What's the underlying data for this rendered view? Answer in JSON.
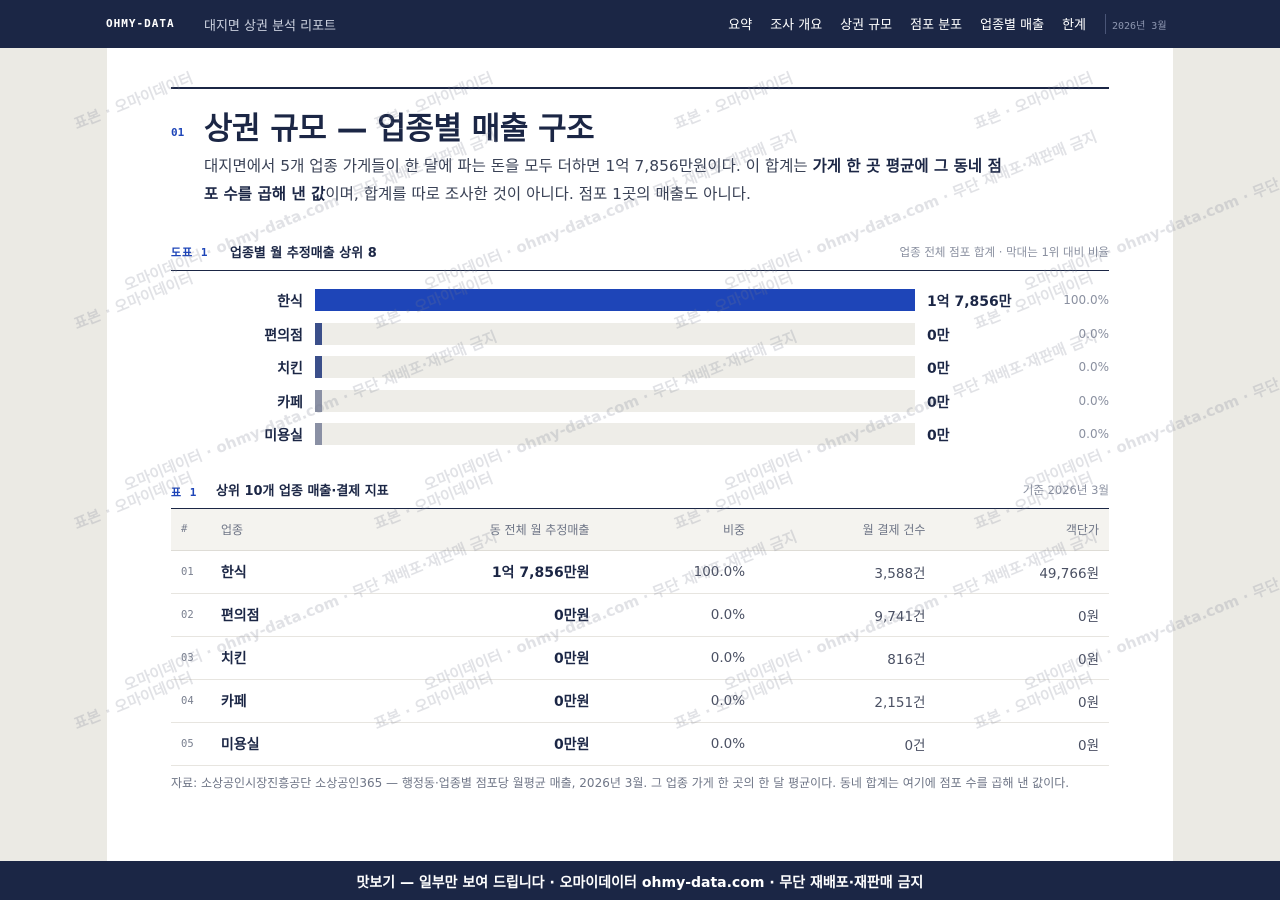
{
  "header": {
    "brand": "OHMY-DATA",
    "report_title": "대지면 상권 분석 리포트",
    "nav": [
      "요약",
      "조사 개요",
      "상권 규모",
      "점포 분포",
      "업종별 매출",
      "한계"
    ],
    "date": "2026년 3월"
  },
  "section": {
    "number": "01",
    "title": "상권 규모 — 업종별 매출 구조",
    "lead_1": "대지면에서 5개 업종 가게들이 한 달에 파는 돈을 모두 더하면 1억 7,856만원이다. 이 합계는 ",
    "lead_bold": "가게 한 곳 평균에 그 동네 점포 수를 곱해 낸 값",
    "lead_2": "이며, 합계를 따로 조사한 것이 아니다. 점포 1곳의 매출도 아니다."
  },
  "figure": {
    "label": "도표 1",
    "title": "업종별 월 추정매출 상위 8",
    "note": "업종 전체 점포 합계 · 막대는 1위 대비 비율"
  },
  "chart_data": {
    "type": "bar",
    "orientation": "horizontal",
    "categories": [
      "한식",
      "편의점",
      "치킨",
      "카페",
      "미용실"
    ],
    "values": [
      17856,
      0,
      0,
      0,
      0
    ],
    "value_labels": [
      "1억 7,856만",
      "0만",
      "0만",
      "0만",
      "0만"
    ],
    "pct_labels": [
      "100.0%",
      "0.0%",
      "0.0%",
      "0.0%",
      "0.0%"
    ],
    "colors": [
      "#1e45b8",
      "#3b4f8a",
      "#3b4f8a",
      "#8a90a4",
      "#8a90a4"
    ],
    "unit": "만원"
  },
  "table": {
    "label": "표 1",
    "title": "상위 10개 업종 매출·결제 지표",
    "note": "기준 2026년 3월",
    "columns": [
      "#",
      "업종",
      "동 전체 월 추정매출",
      "비중",
      "월 결제 건수",
      "객단가"
    ],
    "rows": [
      [
        "01",
        "한식",
        "1억 7,856만원",
        "100.0%",
        "3,588건",
        "49,766원"
      ],
      [
        "02",
        "편의점",
        "0만원",
        "0.0%",
        "9,741건",
        "0원"
      ],
      [
        "03",
        "치킨",
        "0만원",
        "0.0%",
        "816건",
        "0원"
      ],
      [
        "04",
        "카페",
        "0만원",
        "0.0%",
        "2,151건",
        "0원"
      ],
      [
        "05",
        "미용실",
        "0만원",
        "0.0%",
        "0건",
        "0원"
      ]
    ]
  },
  "source": "자료: 소상공인시장진흥공단 소상공인365 — 행정동·업종별 점포당 월평균 매출, 2026년 3월. 그 업종 가게 한 곳의 한 달 평균이다. 동네 합계는 여기에 점포 수를 곱해 낸 값이다.",
  "footer": "맛보기 — 일부만 보여 드립니다 · 오마이데이터 ohmy-data.com · 무단 재배포·재판매 금지",
  "watermarks": [
    "표본 · 오마이데이터",
    "오마이데이터 · ohmy-data.com · 무단 재배포·재판매 금지"
  ]
}
